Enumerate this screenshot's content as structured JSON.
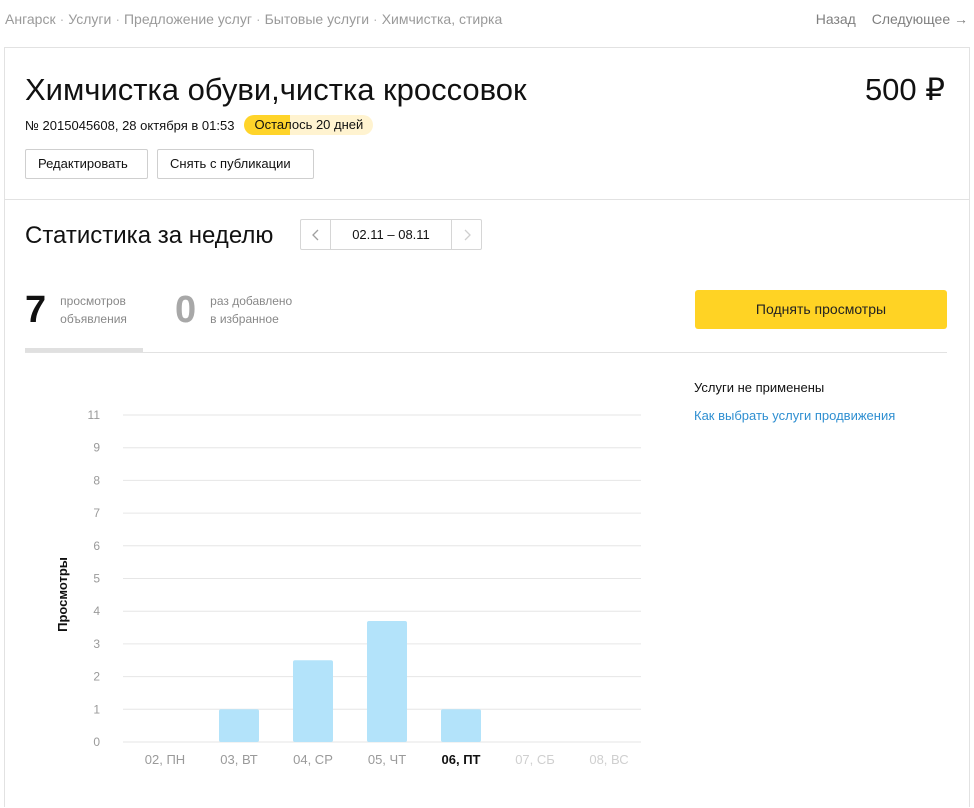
{
  "breadcrumbs": [
    "Ангарск",
    "Услуги",
    "Предложение услуг",
    "Бытовые услуги",
    "Химчистка, стирка"
  ],
  "pager": {
    "back": "Назад",
    "next": "Следующее →"
  },
  "ad": {
    "title": "Химчистка обуви,чистка кроссовок",
    "price": "500 ₽",
    "meta": "№ 2015045608, 28 октября в 01:53",
    "badge": "Осталось 20 дней",
    "edit_label": "Редактировать",
    "unpublish_label": "Снять с публикации"
  },
  "stats": {
    "title": "Статистика за неделю",
    "range": "02.11 – 08.11",
    "prev_icon": "chevron-left-icon",
    "next_icon": "chevron-right-icon",
    "views": {
      "value": "7",
      "label_line1": "просмотров",
      "label_line2": "объявления"
    },
    "favorites": {
      "value": "0",
      "label_line1": "раз добавлено",
      "label_line2": "в избранное"
    },
    "boost_label": "Поднять просмотры"
  },
  "services": {
    "none": "Услуги не применены",
    "link": "Как выбрать услуги продвижения"
  },
  "colors": {
    "bar": "#b3e3fa",
    "accent": "#ffd324",
    "link": "#2f8fd1",
    "badge": "#ffd42a"
  },
  "chart_data": {
    "type": "bar",
    "ylabel": "Просмотры",
    "ylim": [
      0,
      11
    ],
    "yticks": [
      0,
      1,
      2,
      3,
      4,
      5,
      6,
      7,
      8,
      9,
      11
    ],
    "categories": [
      "02, ПН",
      "03, ВТ",
      "04, СР",
      "05, ЧТ",
      "06, ПТ",
      "07, СБ",
      "08, ВС"
    ],
    "values": [
      0,
      1,
      2.5,
      3.7,
      1,
      0,
      0
    ],
    "category_state": [
      "past",
      "past",
      "past",
      "past",
      "current",
      "future",
      "future"
    ],
    "grid": true
  }
}
